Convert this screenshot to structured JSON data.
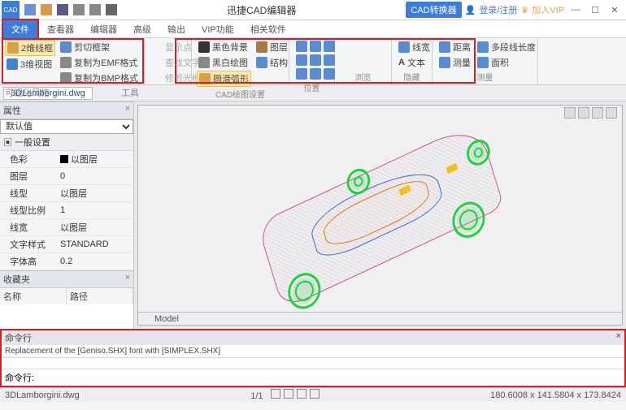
{
  "titlebar": {
    "logo": "CAD",
    "title": "迅捷CAD编辑器",
    "convert_btn": "CAD转换器",
    "login": "登录/注册",
    "vip": "加入VIP"
  },
  "menu": {
    "file": "文件",
    "viewer": "查看器",
    "editor": "编辑器",
    "advanced": "高级",
    "output": "输出",
    "vip": "VIP功能",
    "plugins": "相关软件"
  },
  "ribbon": {
    "grp1": {
      "wire2d": "2维线框",
      "view3d": "3维视图",
      "clip": "剪切框架",
      "emf": "复制为EMF格式",
      "bmp": "复制为BMP格式",
      "label": "可视化风格",
      "label2": "工具"
    },
    "grp2": {
      "showpt": "显示点",
      "findtxt": "查找文字",
      "restore": "修剪光栅"
    },
    "grp3": {
      "blackbg": "黑色背景",
      "bwdraw": "黑白绘图",
      "smooth": "圆滑弧形",
      "layer": "图层",
      "struct": "结构",
      "label": "CAD绘图设置"
    },
    "grp4": {
      "label": "位置"
    },
    "grp5": {
      "label": "浏览"
    },
    "grp6": {
      "line": "线宽",
      "text": "文本",
      "label": "隐藏"
    },
    "grp7": {
      "dist": "距离",
      "meas": "测量",
      "polylen": "多段线长度",
      "area": "面积",
      "label": "测量"
    }
  },
  "doc": {
    "filename": "3DLamborgini.dwg"
  },
  "props": {
    "panel": "属性",
    "default": "默认值",
    "category": "一般设置",
    "color_k": "色彩",
    "color_v": "以图层",
    "layer_k": "图层",
    "layer_v": "0",
    "ltype_k": "线型",
    "ltype_v": "以图层",
    "lscale_k": "线型比例",
    "lscale_v": "1",
    "lweight_k": "线宽",
    "lweight_v": "以图层",
    "tstyle_k": "文字样式",
    "tstyle_v": "STANDARD",
    "theight_k": "字体高",
    "theight_v": "0.2"
  },
  "fav": {
    "panel": "收藏夹",
    "name": "名称",
    "path": "路径"
  },
  "viewport": {
    "tab": "Model"
  },
  "cmd": {
    "panel": "命令行",
    "log": "Replacement of the [Geniso.SHX] font with [SIMPLEX.SHX]",
    "prompt": "命令行:"
  },
  "status": {
    "file": "3DLamborgini.dwg",
    "pages": "1/1",
    "coords": "180.6008 x 141.5804 x 173.8424"
  }
}
